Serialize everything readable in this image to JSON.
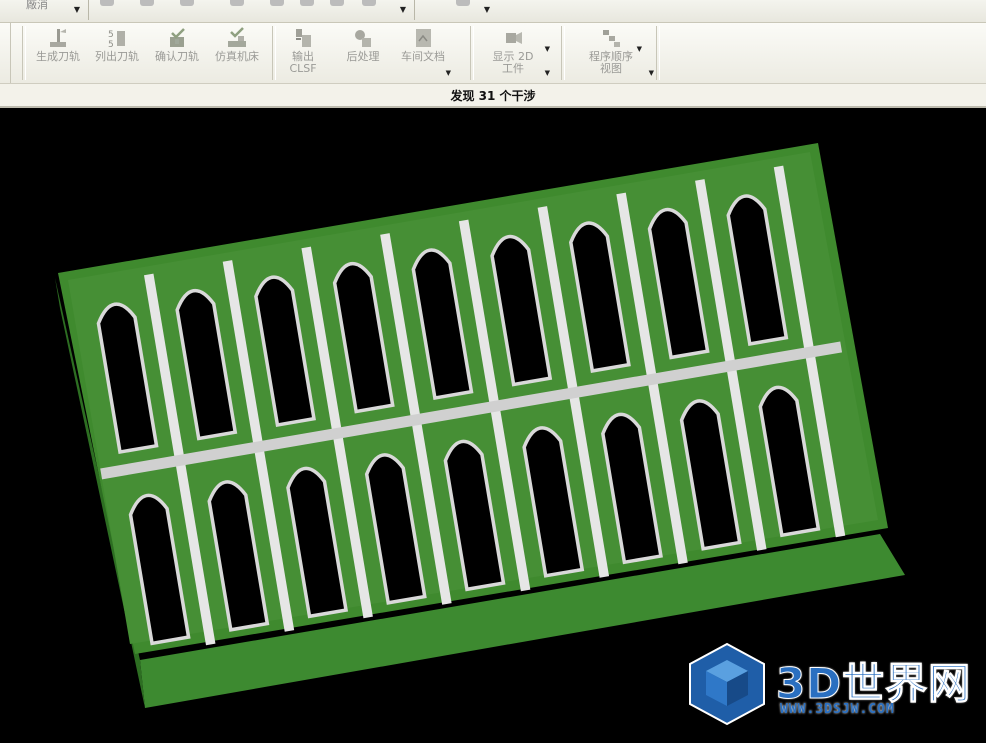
{
  "top_strip": {
    "cut_label": "廠消"
  },
  "toolbar": {
    "items": [
      {
        "id": "generate-toolpath",
        "label": "生成刀轨",
        "icon": "generate-toolpath-icon"
      },
      {
        "id": "list-toolpath",
        "label": "列出刀轨",
        "icon": "list-toolpath-icon"
      },
      {
        "id": "verify-toolpath",
        "label": "确认刀轨",
        "icon": "verify-toolpath-icon"
      },
      {
        "id": "simulate-machine",
        "label": "仿真机床",
        "icon": "simulate-machine-icon"
      },
      {
        "id": "output-clsf",
        "label": "输出\nCLSF",
        "icon": "output-clsf-icon"
      },
      {
        "id": "postprocess",
        "label": "后处理",
        "icon": "postprocess-icon"
      },
      {
        "id": "shop-docs",
        "label": "车间文档",
        "icon": "shop-docs-icon"
      },
      {
        "id": "show-2d-workpiece",
        "label": "显示 2D\n工件",
        "icon": "show-2d-workpiece-icon"
      },
      {
        "id": "program-order-view",
        "label": "程序顺序\n视图",
        "icon": "program-order-view-icon"
      }
    ]
  },
  "status": {
    "message": "发现 31 个干涉"
  },
  "watermark": {
    "title": "3D世界网",
    "url": "WWW.3DSJW.COM"
  },
  "colors": {
    "background": "#000000",
    "part_green": "#3f8a2e",
    "part_dark_green": "#2c6a1f",
    "pocket_wall": "#d9d9d9",
    "brand_blue": "#2a6fc0"
  }
}
